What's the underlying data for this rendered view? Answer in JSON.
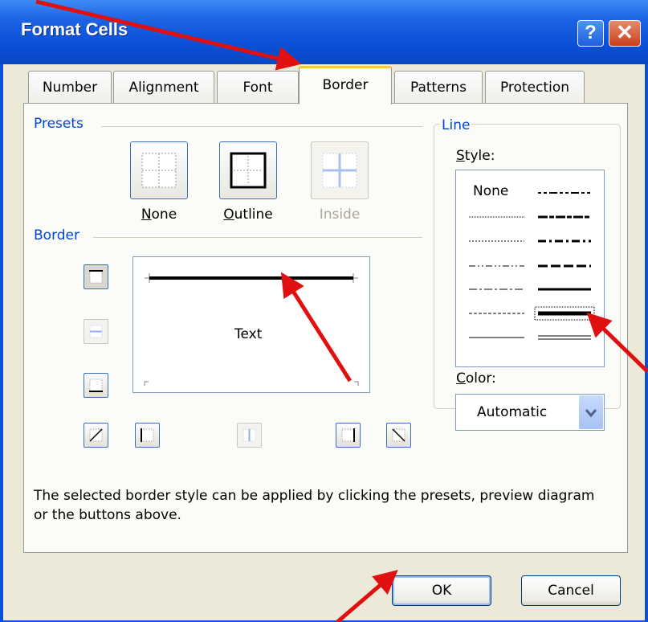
{
  "window": {
    "title": "Format Cells",
    "help_label": "?",
    "close_label": "✕"
  },
  "tabs": [
    {
      "label": "Number"
    },
    {
      "label": "Alignment"
    },
    {
      "label": "Font"
    },
    {
      "label": "Border"
    },
    {
      "label": "Patterns"
    },
    {
      "label": "Protection"
    }
  ],
  "presets": {
    "group_label": "Presets",
    "none": {
      "access": "N",
      "rest": "one"
    },
    "outline": {
      "access": "O",
      "rest": "utline"
    },
    "inside": {
      "label": "Inside"
    }
  },
  "border": {
    "group_label": "Border",
    "preview_text": "Text"
  },
  "line": {
    "group_label": "Line",
    "style_label": {
      "access": "S",
      "rest": "tyle:"
    },
    "style_none": "None",
    "color_label": {
      "access": "C",
      "rest": "olor:"
    },
    "color_value": "Automatic"
  },
  "description": "The selected border style can be applied by clicking the presets, preview diagram or the buttons above.",
  "buttons": {
    "ok": "OK",
    "cancel": "Cancel"
  },
  "colors": {
    "title_bar": "#0a4fd6",
    "dialog_bg": "#ece9d8",
    "group_label": "#0046d5",
    "active_tab_accent": "#ffc83c",
    "annotation_arrow": "#e01010"
  }
}
